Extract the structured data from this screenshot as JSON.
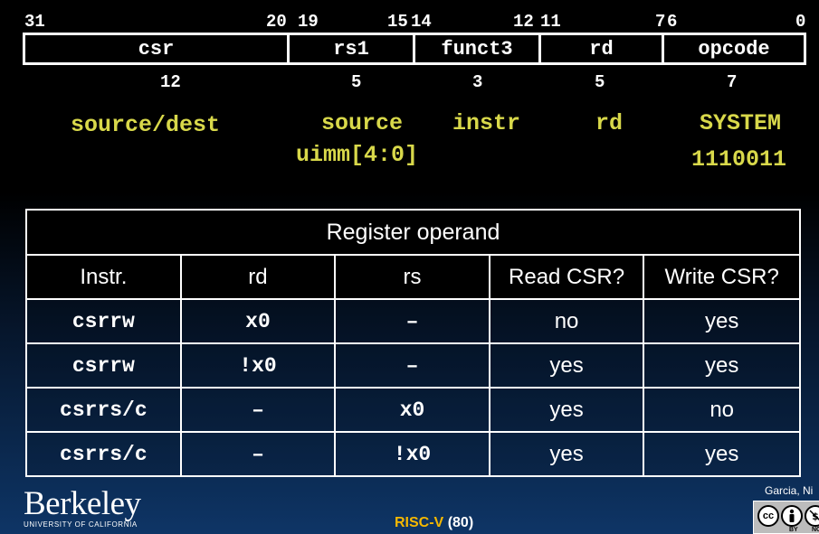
{
  "encoding": {
    "bits": {
      "b31": "31",
      "b20": "20",
      "b19": "19",
      "b15": "15",
      "b14": "14",
      "b12": "12",
      "b11": "11",
      "b7": "7",
      "b6": "6",
      "b0": "0"
    },
    "fields": {
      "csr": "csr",
      "rs1": "rs1",
      "funct3": "funct3",
      "rd": "rd",
      "opcode": "opcode"
    },
    "widths": {
      "csr": "12",
      "rs1": "5",
      "funct3": "3",
      "rd": "5",
      "opcode": "7"
    }
  },
  "labels": {
    "csr": "source/dest",
    "rs1_line1": "source",
    "rs1_line2": "uimm[4:0]",
    "funct3": "instr",
    "rd": "rd",
    "opcode_line1": "SYSTEM",
    "opcode_line2": "1110011"
  },
  "table": {
    "title": "Register operand",
    "headers": [
      "Instr.",
      "rd",
      "rs",
      "Read CSR?",
      "Write CSR?"
    ],
    "rows": [
      [
        "csrrw",
        "x0",
        "–",
        "no",
        "yes"
      ],
      [
        "csrrw",
        "!x0",
        "–",
        "yes",
        "yes"
      ],
      [
        "csrrs/c",
        "–",
        "x0",
        "yes",
        "no"
      ],
      [
        "csrrs/c",
        "–",
        "!x0",
        "yes",
        "yes"
      ]
    ]
  },
  "footer": {
    "logo_word": "Berkeley",
    "logo_sub": "UNIVERSITY OF CALIFORNIA",
    "page_label_prefix": "RISC-V",
    "page_label_num": "(80)",
    "author": "Garcia, Ni",
    "license": {
      "cc": "cc",
      "by": "BY",
      "nc": "NC"
    }
  },
  "colors": {
    "highlight_text": "#d8d84a",
    "risc_v_label": "#f5b800",
    "page_number": "#ffffff"
  }
}
